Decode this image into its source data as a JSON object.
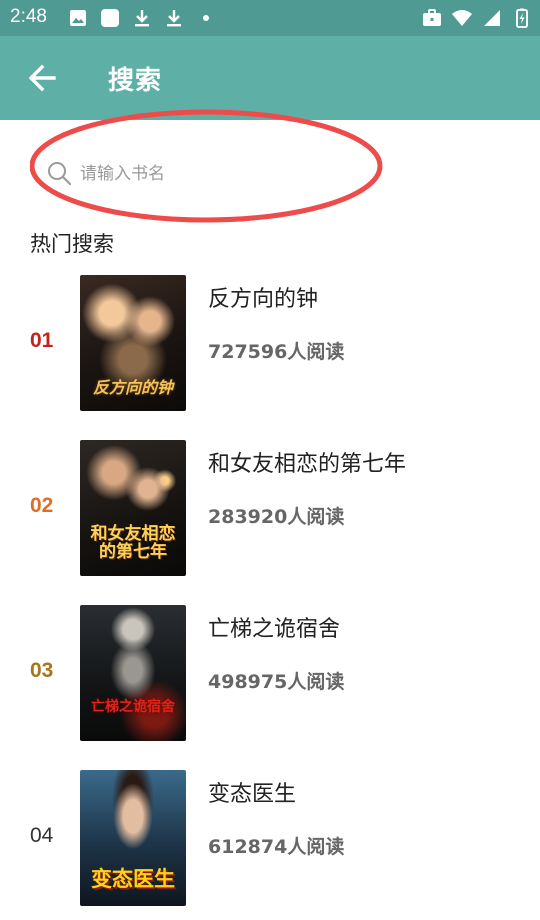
{
  "status_bar": {
    "time": "2:48",
    "left_icons": [
      "image-icon",
      "square-app-icon",
      "download-icon",
      "download-icon",
      "dot-icon"
    ],
    "right_icons": [
      "briefcase-icon",
      "wifi-icon",
      "signal-icon",
      "battery-icon"
    ]
  },
  "app_bar": {
    "back_icon": "arrow-left-icon",
    "title": "搜索",
    "color": "#5eb0a6"
  },
  "search": {
    "placeholder": "请输入书名",
    "value": "",
    "highlight_color": "#ee4b4b"
  },
  "hot": {
    "title": "热门搜索",
    "books": [
      {
        "rank": "01",
        "title": "反方向的钟",
        "reads": "727596人阅读",
        "cover_text": "反方向的钟"
      },
      {
        "rank": "02",
        "title": "和女友相恋的第七年",
        "reads": "283920人阅读",
        "cover_text": "和女友相恋的第七年"
      },
      {
        "rank": "03",
        "title": "亡梯之诡宿舍",
        "reads": "498975人阅读",
        "cover_text": "亡梯之诡宿舍"
      },
      {
        "rank": "04",
        "title": "变态医生",
        "reads": "612874人阅读",
        "cover_text": "变态医生"
      }
    ]
  }
}
